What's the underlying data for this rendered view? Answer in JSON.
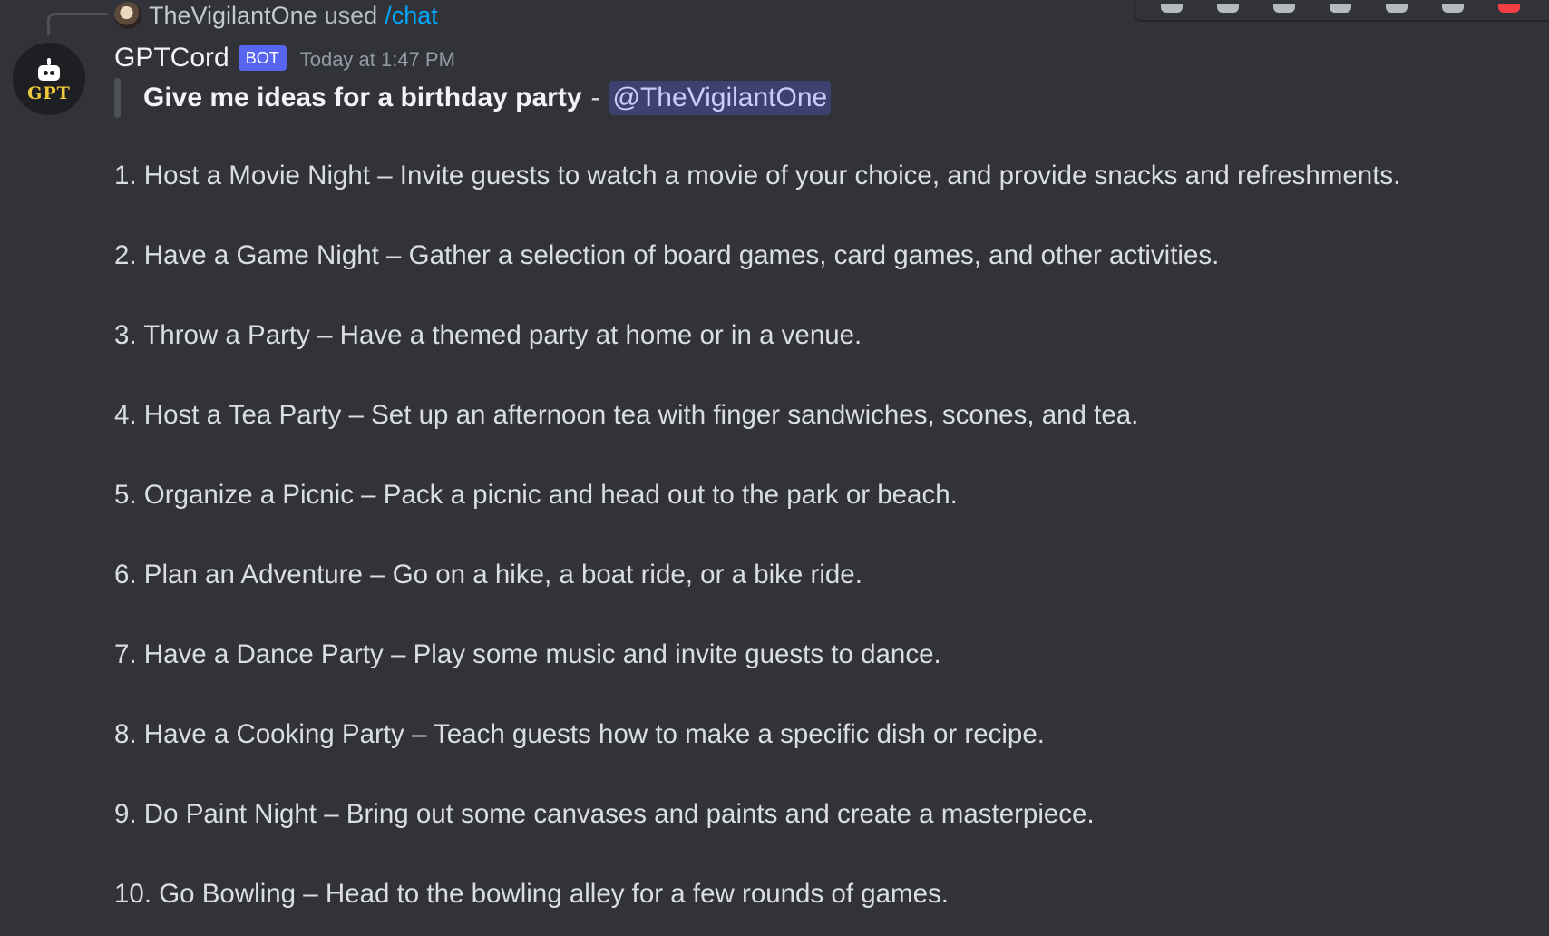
{
  "reply": {
    "user": "TheVigilantOne",
    "used": "used",
    "command": "/chat"
  },
  "bot": {
    "avatar_text": "GPT",
    "name": "GPTCord",
    "badge": "BOT",
    "timestamp": "Today at 1:47 PM"
  },
  "quote": {
    "text": "Give me ideas for a birthday party",
    "separator": "-",
    "mention": "@TheVigilantOne"
  },
  "ideas": [
    "1. Host a Movie Night – Invite guests to watch a movie of your choice, and provide snacks and refreshments.",
    "2. Have a Game Night – Gather a selection of board games, card games, and other activities.",
    "3. Throw a Party – Have a themed party at home or in a venue.",
    "4. Host a Tea Party – Set up an afternoon tea with finger sandwiches, scones, and tea.",
    "5. Organize a Picnic – Pack a picnic and head out to the park or beach.",
    "6. Plan an Adventure – Go on a hike, a boat ride, or a bike ride.",
    "7. Have a Dance Party – Play some music and invite guests to dance.",
    "8. Have a Cooking Party – Teach guests how to make a specific dish or recipe.",
    "9. Do Paint Night – Bring out some canvases and paints and create a masterpiece.",
    "10. Go Bowling – Head to the bowling alley for a few rounds of games."
  ],
  "toolbar": {
    "icons": [
      "reaction-icon",
      "thread-icon",
      "reply-icon",
      "cross-icon",
      "edit-icon",
      "more-icon",
      "delete-icon"
    ]
  },
  "colors": {
    "background": "#313338",
    "mention_bg": "#4a4f8a",
    "badge": "#5865f2",
    "command": "#00a8fc",
    "avatar_text": "#f0c93c"
  }
}
